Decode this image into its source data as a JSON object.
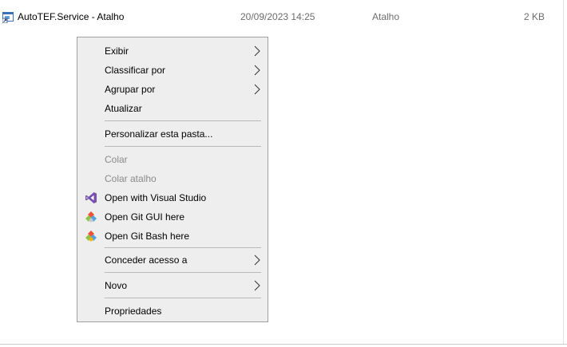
{
  "file": {
    "name": "AutoTEF.Service - Atalho",
    "date_modified": "20/09/2023 14:25",
    "type": "Atalho",
    "size": "2 KB",
    "icon": "shortcut-icon"
  },
  "menu": {
    "items": [
      {
        "label": "Exibir",
        "submenu": true,
        "enabled": true
      },
      {
        "label": "Classificar por",
        "submenu": true,
        "enabled": true
      },
      {
        "label": "Agrupar por",
        "submenu": true,
        "enabled": true
      },
      {
        "label": "Atualizar",
        "submenu": false,
        "enabled": true
      },
      {
        "label": "Personalizar esta pasta...",
        "submenu": false,
        "enabled": true
      },
      {
        "label": "Colar",
        "submenu": false,
        "enabled": false
      },
      {
        "label": "Colar atalho",
        "submenu": false,
        "enabled": false
      },
      {
        "label": "Open with Visual Studio",
        "submenu": false,
        "enabled": true,
        "icon": "visual-studio-icon"
      },
      {
        "label": "Open Git GUI here",
        "submenu": false,
        "enabled": true,
        "icon": "git-gui-icon"
      },
      {
        "label": "Open Git Bash here",
        "submenu": false,
        "enabled": true,
        "icon": "git-bash-icon"
      },
      {
        "label": "Conceder acesso a",
        "submenu": true,
        "enabled": true
      },
      {
        "label": "Novo",
        "submenu": true,
        "enabled": true
      },
      {
        "label": "Propriedades",
        "submenu": false,
        "enabled": true
      }
    ]
  },
  "colors": {
    "menu_background": "#eeeeee",
    "menu_border": "#a0a0a0",
    "disabled_text": "#8a8a8a",
    "secondary_text": "#6d6d6d",
    "visual_studio_purple": "#7b52ab",
    "git_orange": "#f05033"
  }
}
